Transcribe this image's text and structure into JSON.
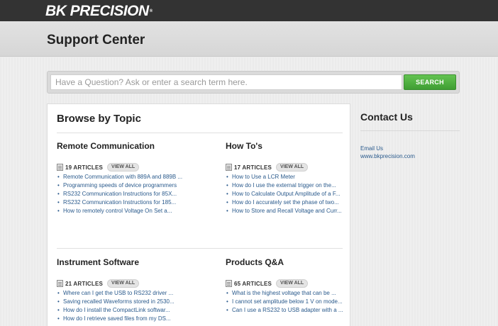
{
  "brand": {
    "logo_text": "BK PRECISION",
    "trademark": "®"
  },
  "header": {
    "title": "Support Center"
  },
  "search": {
    "placeholder": "Have a Question? Ask or enter a search term here.",
    "button_label": "SEARCH"
  },
  "browse": {
    "title": "Browse by Topic",
    "topics": [
      {
        "title": "Remote Communication",
        "count": "19 ARTICLES",
        "view_all": "VIEW ALL",
        "articles": [
          "Remote Communication with 889A and 889B ...",
          "Programming speeds of device programmers",
          "RS232 Communication Instructions for 85X...",
          "RS232 Communication Instructions for 185...",
          "How to remotely control Voltage On Set a..."
        ]
      },
      {
        "title": "How To's",
        "count": "17 ARTICLES",
        "view_all": "VIEW ALL",
        "articles": [
          "How to Use a LCR Meter",
          "How do I use the external trigger on the...",
          "How to Calculate Output Amplitude of a F...",
          "How do I accurately set the phase of two...",
          "How to Store and Recall Voltage and Curr..."
        ]
      },
      {
        "title": "Instrument Software",
        "count": "21 ARTICLES",
        "view_all": "VIEW ALL",
        "articles": [
          "Where can I get the USB to RS232 driver ...",
          "Saving recalled Waveforms stored in 2530...",
          "How do I install the CompactLink softwar...",
          "How do I retrieve saved files from my DS..."
        ]
      },
      {
        "title": "Products Q&A",
        "count": "65 ARTICLES",
        "view_all": "VIEW ALL",
        "articles": [
          "What is the highest voltage that can be ...",
          "I cannot set amplitude below 1 V on mode...",
          "Can I use a RS232 to USB adapter with a ..."
        ]
      }
    ]
  },
  "contact": {
    "title": "Contact Us",
    "email_label": "Email Us",
    "website": "www.bkprecision.com"
  },
  "colors": {
    "accent_green": "#4caf3e",
    "link_blue": "#2a5a8c",
    "topbar": "#333333"
  }
}
